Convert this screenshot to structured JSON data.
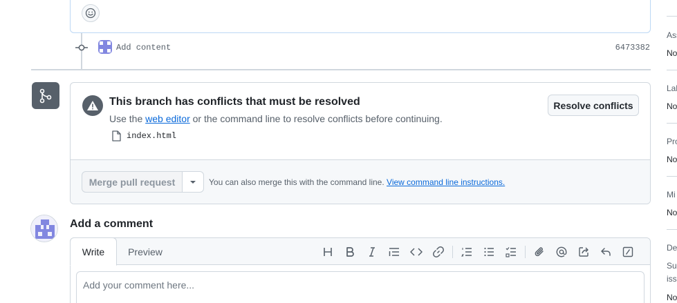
{
  "timeline": {
    "commit": {
      "message": "Add content",
      "sha": "6473382"
    }
  },
  "conflict": {
    "title": "This branch has conflicts that must be resolved",
    "desc_pre": "Use the ",
    "desc_link": "web editor",
    "desc_post": " or the command line to resolve conflicts before continuing.",
    "file": "index.html",
    "resolve_label": "Resolve conflicts"
  },
  "merge": {
    "button_label": "Merge pull request",
    "note": "You can also merge this with the command line.",
    "note_link": "View command line instructions."
  },
  "comment": {
    "title": "Add a comment",
    "tab_write": "Write",
    "tab_preview": "Preview",
    "placeholder": "Add your comment here...",
    "toolbar_icons": [
      "heading-icon",
      "bold-icon",
      "italic-icon",
      "quote-icon",
      "code-icon",
      "link-icon",
      "ordered-list-icon",
      "unordered-list-icon",
      "task-list-icon",
      "attach-icon",
      "mention-icon",
      "reference-icon",
      "reply-icon",
      "slash-command-icon"
    ]
  },
  "sidebar": {
    "sections": [
      {
        "heading": "Ass",
        "value": "No"
      },
      {
        "heading": "Lab",
        "value": "No"
      },
      {
        "heading": "Pro",
        "value": "No"
      },
      {
        "heading": "Mi",
        "value": "No"
      },
      {
        "heading": "De",
        "value_1": "Suc",
        "value_2": "iss",
        "value_3": "No"
      }
    ]
  },
  "colors": {
    "accent": "#0969da",
    "muted": "#57606a",
    "border": "#d0d7de",
    "avatar": "#8287e0"
  }
}
